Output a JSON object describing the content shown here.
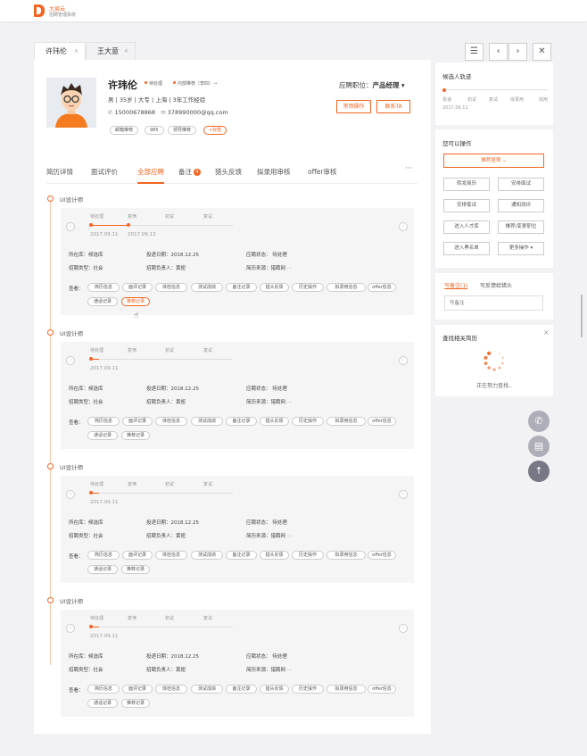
{
  "brand": {
    "name": "大易云",
    "subtitle": "招聘管理系统",
    "color": "#f26522"
  },
  "tabs": [
    {
      "label": "许玮伦"
    },
    {
      "label": "王大意"
    }
  ],
  "toolbar": {
    "menu_icon": "☰",
    "prev_icon": "‹",
    "next_icon": "›",
    "close_icon": "✕"
  },
  "candidate": {
    "name": "许玮伦",
    "status_tag": "待处理",
    "source_tag": "内部推荐（李四）→",
    "basic": "男 | 35岁 | 大专 | 上海 | 3年工作经验",
    "phone": "15000678868",
    "email": "378990000@qq.com",
    "chips": [
      "邮箱推荐",
      "985",
      "领导推荐",
      "+标签"
    ],
    "position_label": "应聘职位：",
    "position": "产品经理",
    "btn_ops": "常用操作",
    "btn_contact": "联系TA"
  },
  "nav_tabs": [
    "简历详情",
    "面试评价",
    "全部应聘",
    "备注",
    "猎头反馈",
    "拟录用审核",
    "offer审核"
  ],
  "nav_badge": "4",
  "nav_more": "···",
  "applications": [
    {
      "title": "UI设计师",
      "stages": [
        "待处理",
        "复筛",
        "初试",
        "复试"
      ],
      "dates": [
        "2017.09.11",
        "2017.09.13"
      ],
      "progress": 2
    },
    {
      "title": "UI设计师",
      "stages": [
        "待处理",
        "复筛",
        "初试",
        "复试"
      ],
      "dates": [
        "2017.09.11"
      ],
      "progress": 1
    },
    {
      "title": "UI设计师",
      "stages": [
        "待处理",
        "复筛",
        "初试",
        "复试"
      ],
      "dates": [
        "2017.09.11"
      ],
      "progress": 1
    },
    {
      "title": "UI设计师",
      "stages": [
        "待处理",
        "复筛",
        "初试",
        "复试"
      ],
      "dates": [
        "2017.09.11"
      ],
      "progress": 1
    }
  ],
  "app_info": {
    "store": "所在库：候选库",
    "date": "投递日期：2018.12.25",
    "status": "应聘状态：  待处理",
    "type": "招聘类型：社会",
    "owner": "招聘负责人：黄妞",
    "source": "简历来源：猎聘网",
    "source_more": "···",
    "view_label": "查看："
  },
  "pills": [
    "简历信息",
    "面评记录",
    "体检信息",
    "测试成绩",
    "备注记录",
    "猎头反馈",
    "历史操作",
    "拟录用信息",
    "offer信息",
    "通话记录",
    "推荐记录"
  ],
  "trajectory": {
    "title": "候选人轨迹",
    "stages": [
      "投递",
      "初试",
      "复试",
      "拟录用",
      "拟用"
    ],
    "date": "2017.09.11"
  },
  "actions": {
    "title": "您可以操作",
    "primary": "推荐复筛",
    "buttons": [
      "转发简历",
      "安排面试",
      "安排笔试",
      "通知测评",
      "进入人才库",
      "推荐/变更职位",
      "进入黑名单",
      "更多操作 ▾"
    ]
  },
  "note": {
    "title": "写备注(1)",
    "subtitle": "写反馈给猎头",
    "placeholder": "写备注"
  },
  "search": {
    "title": "查找相关简历",
    "loading": "正在努力查找..",
    "close": "×"
  },
  "floats": [
    "✆",
    "▤",
    "↑"
  ]
}
